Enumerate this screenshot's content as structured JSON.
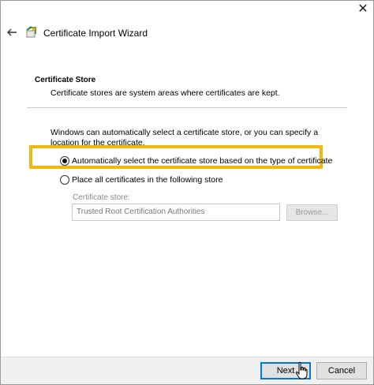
{
  "window": {
    "close_glyph": "✕",
    "title": "Certificate Import Wizard"
  },
  "section": {
    "title": "Certificate Store",
    "description": "Certificate stores are system areas where certificates are kept."
  },
  "body": {
    "intro": "Windows can automatically select a certificate store, or you can specify a location for the certificate.",
    "options": [
      {
        "label": "Automatically select the certificate store based on the type of certificate",
        "selected": true
      },
      {
        "label": "Place all certificates in the following store",
        "selected": false
      }
    ],
    "store_label": "Certificate store:",
    "store_value": "Trusted Root Certification Authorities",
    "browse_label": "Browse..."
  },
  "footer": {
    "next_label": "Next",
    "cancel_label": "Cancel"
  },
  "colors": {
    "highlight": "#f2b90c",
    "focus_border": "#0078d7"
  },
  "icons": [
    "close-icon",
    "back-arrow-icon",
    "certificate-wizard-icon",
    "mouse-cursor-icon"
  ]
}
